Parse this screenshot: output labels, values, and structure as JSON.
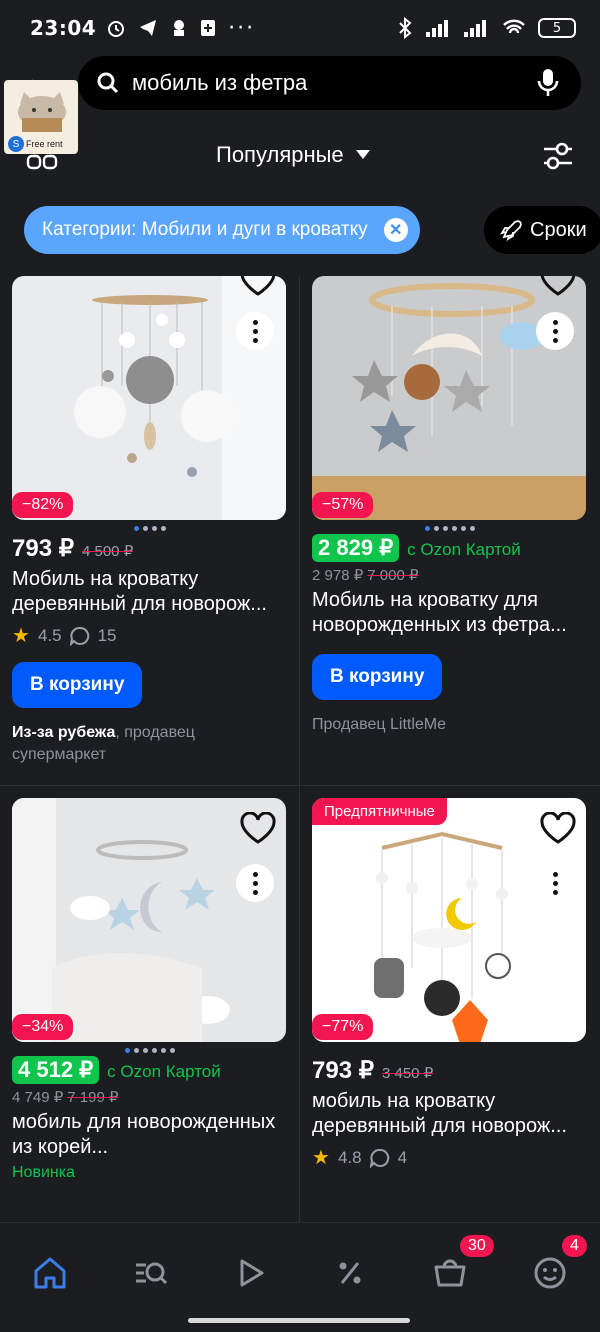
{
  "status": {
    "time": "23:04",
    "battery": "5"
  },
  "search": {
    "query": "мобиль из фетра"
  },
  "overlay": {
    "free_rent": "Free rent",
    "s_letter": "S"
  },
  "sort": {
    "label": "Популярные"
  },
  "chips": {
    "category": "Категории: Мобили и дуги в кроватку",
    "srok": "Сроки"
  },
  "products": [
    {
      "discount": "−82%",
      "price": "793 ₽",
      "old_price": "4 500 ₽",
      "title": "Мобиль на кроватку деревянный для новорож...",
      "rating": "4.5",
      "reviews": "15",
      "cart": "В корзину",
      "seller_bold": "Из-за рубежа",
      "seller_rest": ", продавец супермаркет"
    },
    {
      "discount": "−57%",
      "price": "2 829 ₽",
      "ozon_label": "с Ozon Картой",
      "price_no_card": "2 978 ₽",
      "old_price": "7 000 ₽",
      "title": "Мобиль на кроватку для новорожденных из фетра...",
      "cart": "В корзину",
      "seller": "Продавец LittleMe"
    },
    {
      "discount": "−34%",
      "price": "4 512 ₽",
      "ozon_label": "с Ozon Картой",
      "price_no_card": "4 749 ₽",
      "old_price": "7 199 ₽",
      "title": "мобиль для новорожденных из корей...",
      "badge": "Новинка"
    },
    {
      "promo": "Предпятничные",
      "discount": "−77%",
      "price": "793 ₽",
      "old_price": "3 450 ₽",
      "title": "мобиль на кроватку деревянный для новорож...",
      "rating": "4.8",
      "reviews": "4"
    }
  ],
  "nav": {
    "cart_count": "30",
    "profile_count": "4"
  },
  "colors": {
    "accent": "#005bff",
    "sale": "#f3154f",
    "ozon_green": "#10c44c",
    "chip": "#5aa6ff"
  }
}
